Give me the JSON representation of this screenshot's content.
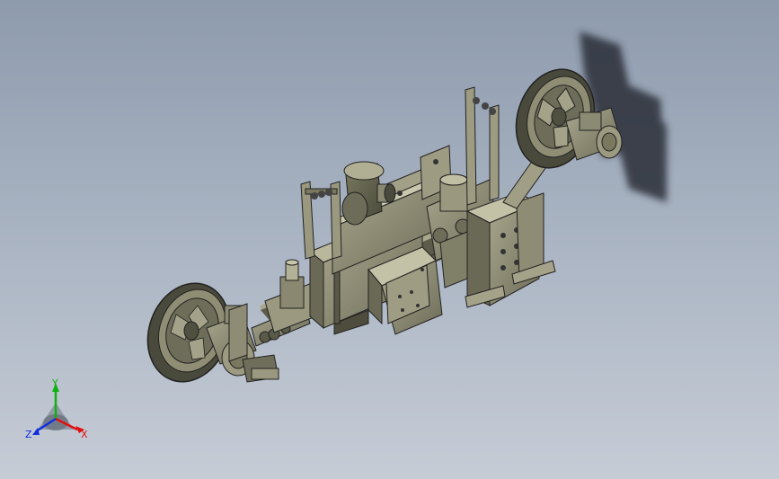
{
  "viewport": {
    "background_top": "#8e9bad",
    "background_bottom": "#c6ccd6"
  },
  "model": {
    "name": "",
    "body_color": "#8b8a72",
    "dark_color": "#3a3a30",
    "shadow_color": "#2a2e38"
  },
  "triad": {
    "x_label": "X",
    "y_label": "Y",
    "z_label": "Z",
    "x_color": "#e01010",
    "y_color": "#10b010",
    "z_color": "#1030e0"
  }
}
